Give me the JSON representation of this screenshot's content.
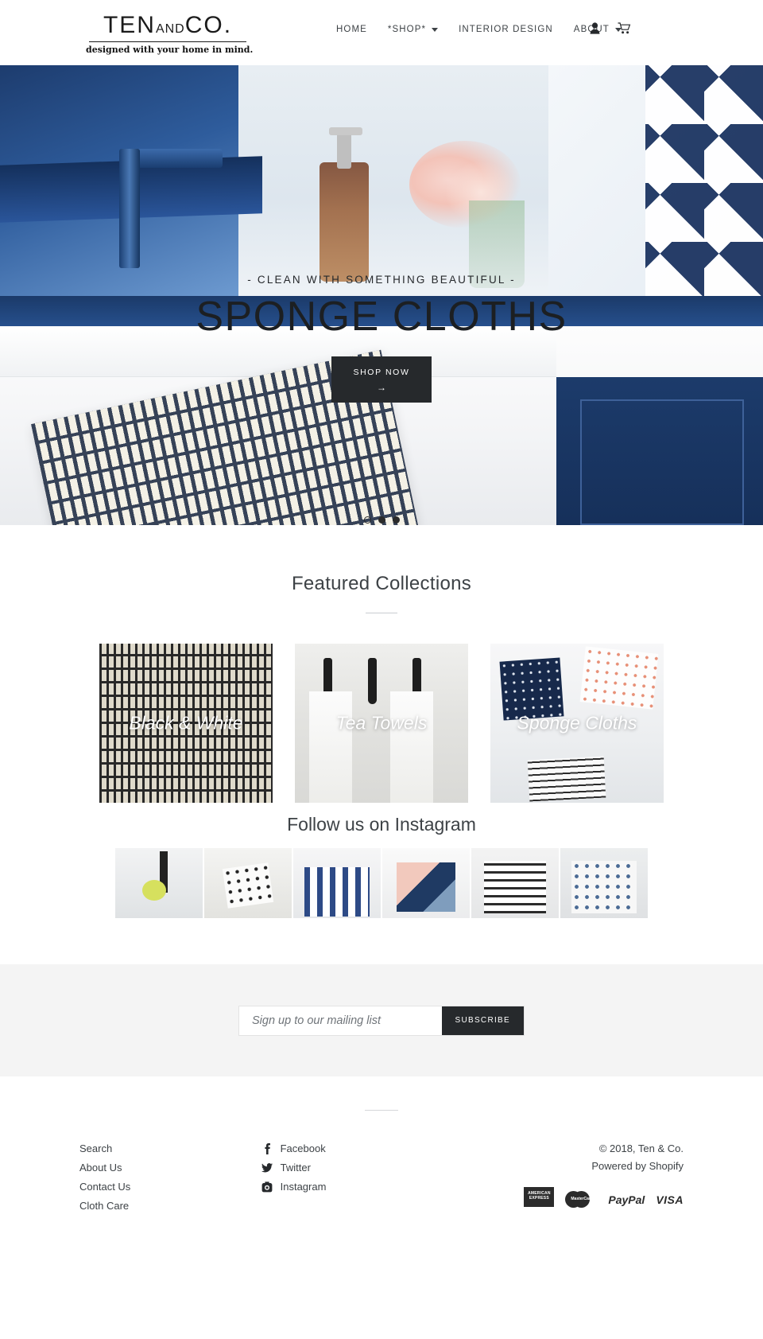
{
  "header": {
    "logo": {
      "line1_part1": "TEN",
      "line1_part2": "AND",
      "line1_part3": "CO.",
      "tagline": "designed with your home in mind."
    },
    "nav": [
      {
        "label": "HOME",
        "has_dropdown": false
      },
      {
        "label": "*SHOP*",
        "has_dropdown": true
      },
      {
        "label": "INTERIOR DESIGN",
        "has_dropdown": false
      },
      {
        "label": "ABOUT",
        "has_dropdown": true
      }
    ],
    "icons": [
      {
        "name": "account-icon",
        "label": "Account"
      },
      {
        "name": "cart-icon",
        "label": "Cart"
      }
    ]
  },
  "hero": {
    "eyebrow": "- CLEAN WITH SOMETHING BEAUTIFUL -",
    "title": "SPONGE CLOTHS",
    "button_label": "SHOP NOW",
    "button_arrow": "→",
    "slides": 3,
    "active_slide": 2
  },
  "featured": {
    "title": "Featured Collections",
    "collections": [
      {
        "label": "Black & White"
      },
      {
        "label": "Tea Towels"
      },
      {
        "label": "Sponge Cloths"
      }
    ]
  },
  "instagram": {
    "title": "Follow us on Instagram",
    "posts": [
      {
        "alt": "sponge cloth in sink"
      },
      {
        "alt": "hanging patterned cloth"
      },
      {
        "alt": "tea towels on hooks"
      },
      {
        "alt": "abstract pattern cloths"
      },
      {
        "alt": "striped tea towels on hooks"
      },
      {
        "alt": "grey patterned cloths"
      }
    ]
  },
  "newsletter": {
    "placeholder": "Sign up to our mailing list",
    "value": "",
    "button_label": "SUBSCRIBE"
  },
  "footer": {
    "links": [
      "Search",
      "About Us",
      "Contact Us",
      "Cloth Care"
    ],
    "social": [
      {
        "label": "Facebook",
        "icon": "facebook-icon"
      },
      {
        "label": "Twitter",
        "icon": "twitter-icon"
      },
      {
        "label": "Instagram",
        "icon": "instagram-icon"
      }
    ],
    "copyright": "© 2018, Ten & Co.",
    "powered_by": "Powered by Shopify",
    "payments": [
      {
        "name": "american-express",
        "label": "AMERICAN EXPRESS"
      },
      {
        "name": "mastercard",
        "label": "MasterCard"
      },
      {
        "name": "paypal",
        "label": "PayPal"
      },
      {
        "name": "visa",
        "label": "VISA"
      }
    ]
  },
  "colors": {
    "dark": "#26292c",
    "text": "#3d4246",
    "navy": "#1c3b6b",
    "newsletter_bg": "#f4f4f4"
  }
}
